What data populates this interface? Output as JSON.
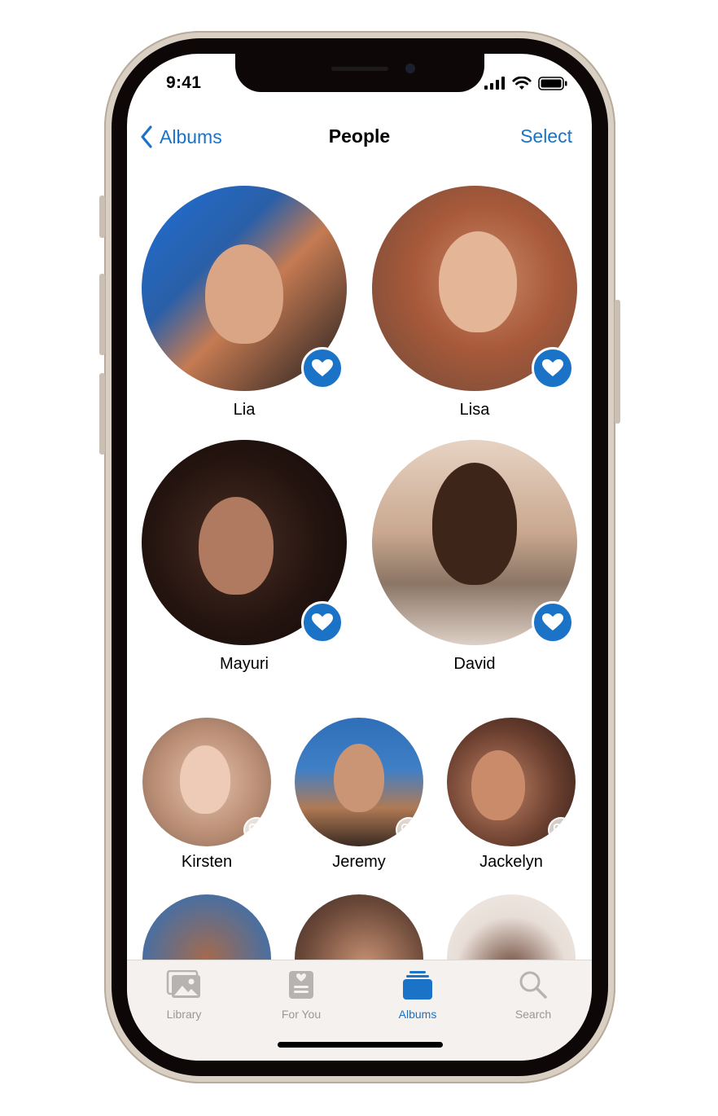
{
  "status_bar": {
    "time": "9:41"
  },
  "nav": {
    "back_label": "Albums",
    "title": "People",
    "select_label": "Select"
  },
  "people_featured": [
    {
      "name": "Lia",
      "favorite": true
    },
    {
      "name": "Lisa",
      "favorite": true
    },
    {
      "name": "Mayuri",
      "favorite": true
    },
    {
      "name": "David",
      "favorite": true
    }
  ],
  "people_others": [
    {
      "name": "Kirsten",
      "favorite": false
    },
    {
      "name": "Jeremy",
      "favorite": false
    },
    {
      "name": "Jackelyn",
      "favorite": false
    }
  ],
  "tab_bar": {
    "tabs": [
      {
        "label": "Library",
        "icon": "photo-library-icon"
      },
      {
        "label": "For You",
        "icon": "for-you-icon"
      },
      {
        "label": "Albums",
        "icon": "albums-icon",
        "active": true
      },
      {
        "label": "Search",
        "icon": "search-icon"
      }
    ]
  },
  "colors": {
    "accent": "#1a73c6",
    "frame": "#d9cfc3",
    "bezel": "#0d0807"
  }
}
